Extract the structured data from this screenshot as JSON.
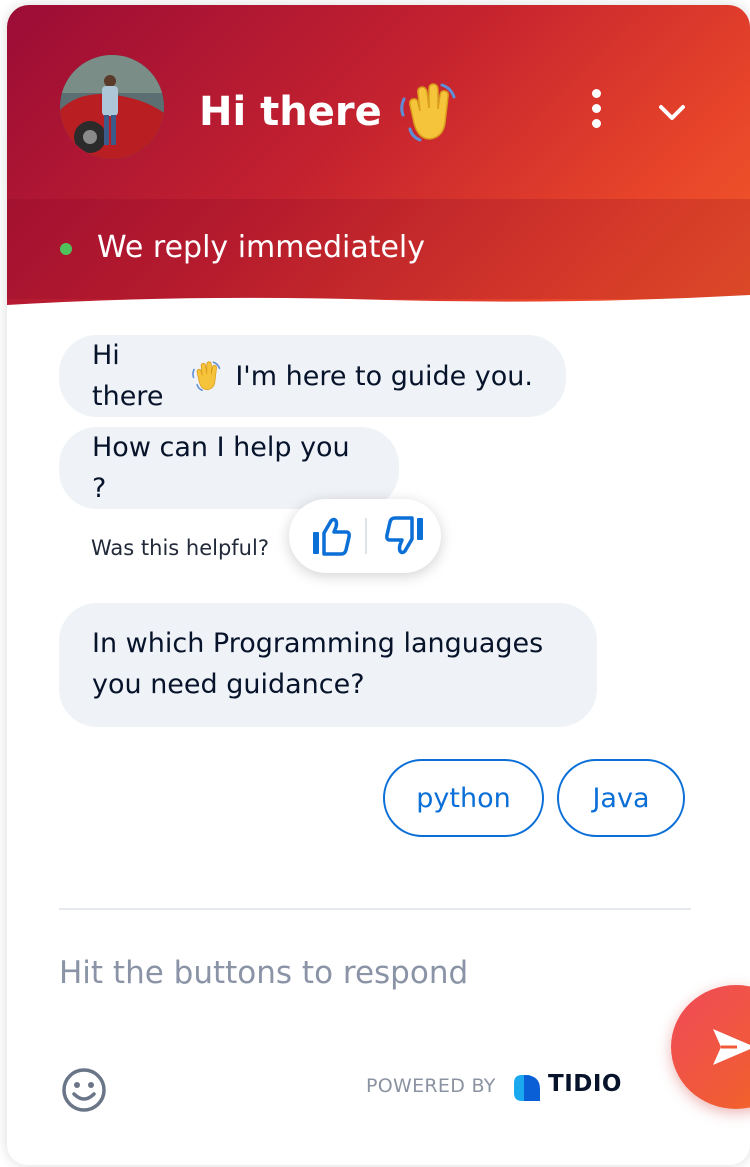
{
  "header": {
    "title": "Hi there",
    "status": "We reply immediately",
    "menu_icon": "kebab-menu-icon",
    "collapse_icon": "chevron-down-icon"
  },
  "messages": [
    {
      "before": "Hi there",
      "after": " I'm here to guide you."
    },
    {
      "text": "How can I help you ?"
    },
    {
      "text": "In which Programming languages you need guidance?"
    }
  ],
  "feedback": {
    "label": "Was this helpful?",
    "up_icon": "thumbs-up-icon",
    "down_icon": "thumbs-down-icon"
  },
  "quick_replies": [
    "python",
    "Java"
  ],
  "composer": {
    "placeholder": "Hit the buttons to respond"
  },
  "footer": {
    "powered_by": "POWERED BY",
    "brand": "TIDIO"
  },
  "colors": {
    "header_start": "#9b0c36",
    "header_end": "#f25a28",
    "accent_blue": "#0b6fd8",
    "bubble_bg": "#eff2f6",
    "status_online": "#4fc25c",
    "send_button": "#f05a38"
  }
}
